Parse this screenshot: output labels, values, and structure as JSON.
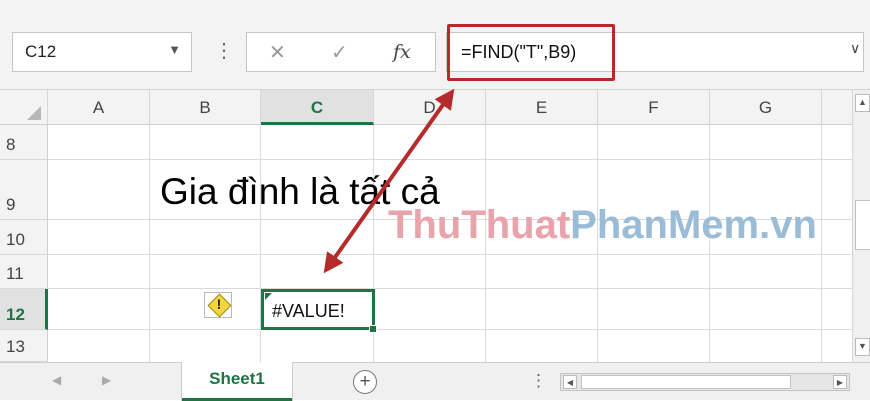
{
  "formula_bar": {
    "name_box": "C12",
    "formula": "=FIND(\"T\",B9)",
    "cancel_icon": "close-icon",
    "confirm_icon": "check-icon",
    "fx_label": "fx",
    "dots": "⋮"
  },
  "grid": {
    "columns": [
      "A",
      "B",
      "C",
      "D",
      "E",
      "F",
      "G"
    ],
    "rows": [
      "8",
      "9",
      "10",
      "11",
      "12",
      "13"
    ],
    "active_column": "C",
    "active_row": "12"
  },
  "cells": {
    "B9": "Gia đình là tất cả",
    "C12": "#VALUE!"
  },
  "watermark": {
    "part1": "ThuThuat",
    "part2": "PhanMem.vn"
  },
  "sheet_tabs": {
    "active": "Sheet1",
    "add_label": "+"
  },
  "colors": {
    "accent_green": "#217346",
    "annotation_red": "#b52a2a"
  }
}
